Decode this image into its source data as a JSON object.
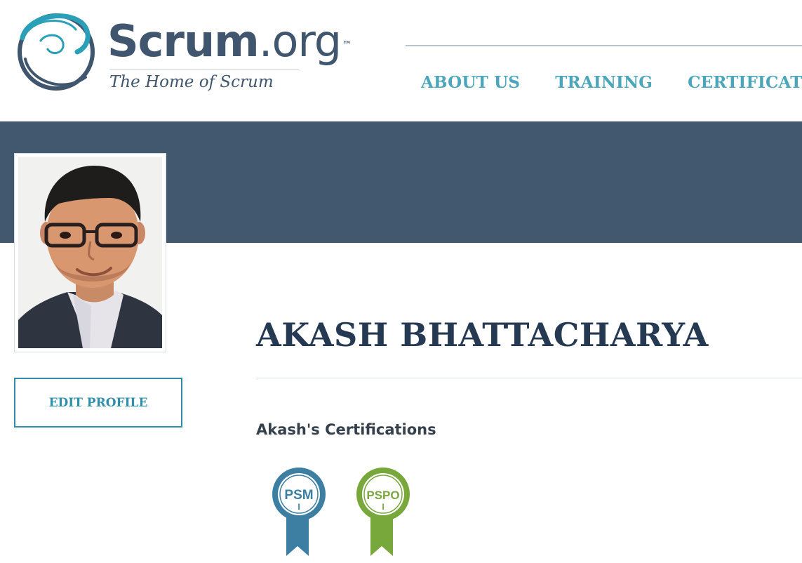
{
  "logo": {
    "brand_primary": "Scrum",
    "brand_secondary": ".org",
    "trademark": "™",
    "tagline": "The Home of Scrum",
    "colors": {
      "ring_teal": "#2aa0b8",
      "ring_dark": "#3f566e"
    }
  },
  "nav": {
    "items": [
      {
        "label": "ABOUT US"
      },
      {
        "label": "TRAINING"
      },
      {
        "label": "CERTIFICATION"
      }
    ],
    "color": "#4ba6bc"
  },
  "banner": {
    "color": "#42586f"
  },
  "profile": {
    "name": "AKASH BHATTACHARYA",
    "edit_button_label": "EDIT PROFILE",
    "certifications_heading": "Akash's Certifications",
    "badges": [
      {
        "abbr": "PSM",
        "level": "I",
        "color": "#3d7fa3"
      },
      {
        "abbr": "PSPO",
        "level": "I",
        "color": "#78a83c"
      }
    ]
  }
}
